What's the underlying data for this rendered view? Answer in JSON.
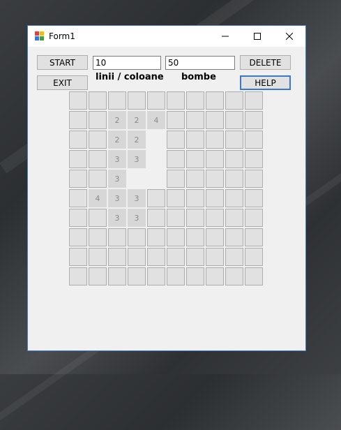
{
  "window": {
    "title": "Form1"
  },
  "controls": {
    "start_label": "START",
    "exit_label": "EXIT",
    "delete_label": "DELETE",
    "help_label": "HELP",
    "size_value": "10",
    "bombs_value": "50",
    "size_caption": "linii / coloane",
    "bombs_caption": "bombe"
  },
  "grid": {
    "rows": 10,
    "cols": 10,
    "revealed": [
      {
        "r": 1,
        "c": 2,
        "v": "2"
      },
      {
        "r": 1,
        "c": 3,
        "v": "2"
      },
      {
        "r": 1,
        "c": 4,
        "v": "4"
      },
      {
        "r": 2,
        "c": 2,
        "v": "2"
      },
      {
        "r": 2,
        "c": 3,
        "v": "2"
      },
      {
        "r": 3,
        "c": 2,
        "v": "3"
      },
      {
        "r": 3,
        "c": 3,
        "v": "3"
      },
      {
        "r": 4,
        "c": 2,
        "v": "3"
      },
      {
        "r": 5,
        "c": 1,
        "v": "4"
      },
      {
        "r": 5,
        "c": 2,
        "v": "3"
      },
      {
        "r": 5,
        "c": 3,
        "v": "3"
      },
      {
        "r": 6,
        "c": 2,
        "v": "3"
      },
      {
        "r": 6,
        "c": 3,
        "v": "3"
      }
    ],
    "empty": [
      {
        "r": 2,
        "c": 4
      },
      {
        "r": 3,
        "c": 4
      },
      {
        "r": 4,
        "c": 3
      },
      {
        "r": 4,
        "c": 4
      }
    ]
  }
}
